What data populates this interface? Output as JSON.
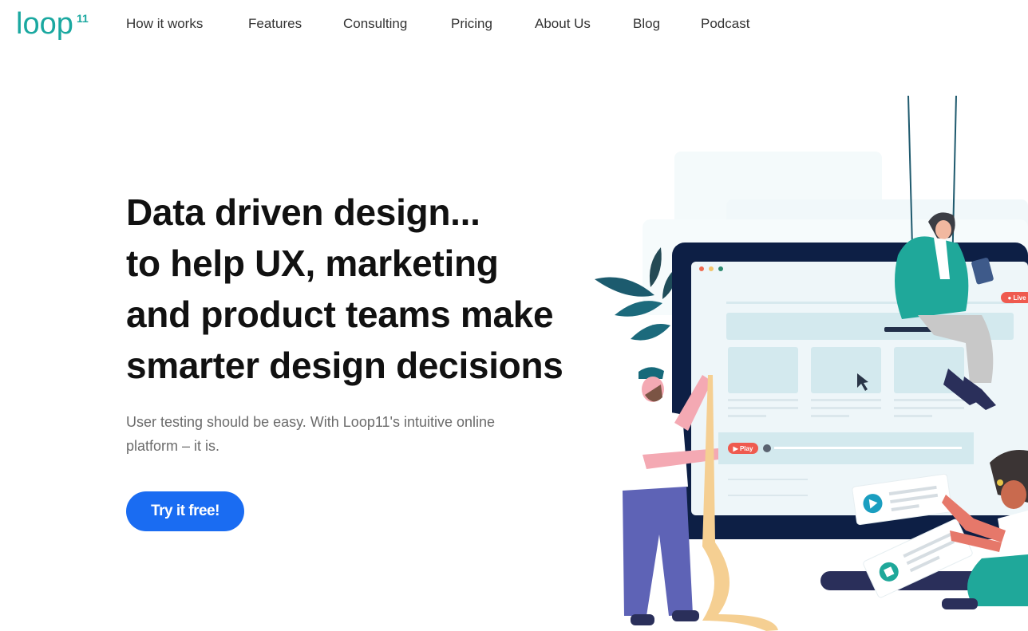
{
  "brand": {
    "name": "Loop11",
    "logo_text": "loop",
    "logo_superscript": "11",
    "accent": "#1aa8a0"
  },
  "nav": {
    "items": [
      {
        "label": "How it works"
      },
      {
        "label": "Features"
      },
      {
        "label": "Consulting"
      },
      {
        "label": "Pricing"
      },
      {
        "label": "About Us"
      },
      {
        "label": "Blog"
      },
      {
        "label": "Podcast"
      }
    ]
  },
  "hero": {
    "title_lines": [
      "Data driven design...",
      "to help UX, marketing",
      "and product teams make",
      "smarter design decisions"
    ],
    "subtitle": "User testing should be easy. With Loop11's intuitive online platform – it is.",
    "cta_label": "Try it free!",
    "cta_color": "#1a6cf2"
  },
  "illustration": {
    "play_badge": "▶ Play",
    "live_badge": "● Live",
    "colors": {
      "monitor": "#0d1f45",
      "screen": "#eaf5f8",
      "panel": "#cfe8ec",
      "teal": "#1fa89a",
      "red": "#ef5a4f"
    }
  }
}
